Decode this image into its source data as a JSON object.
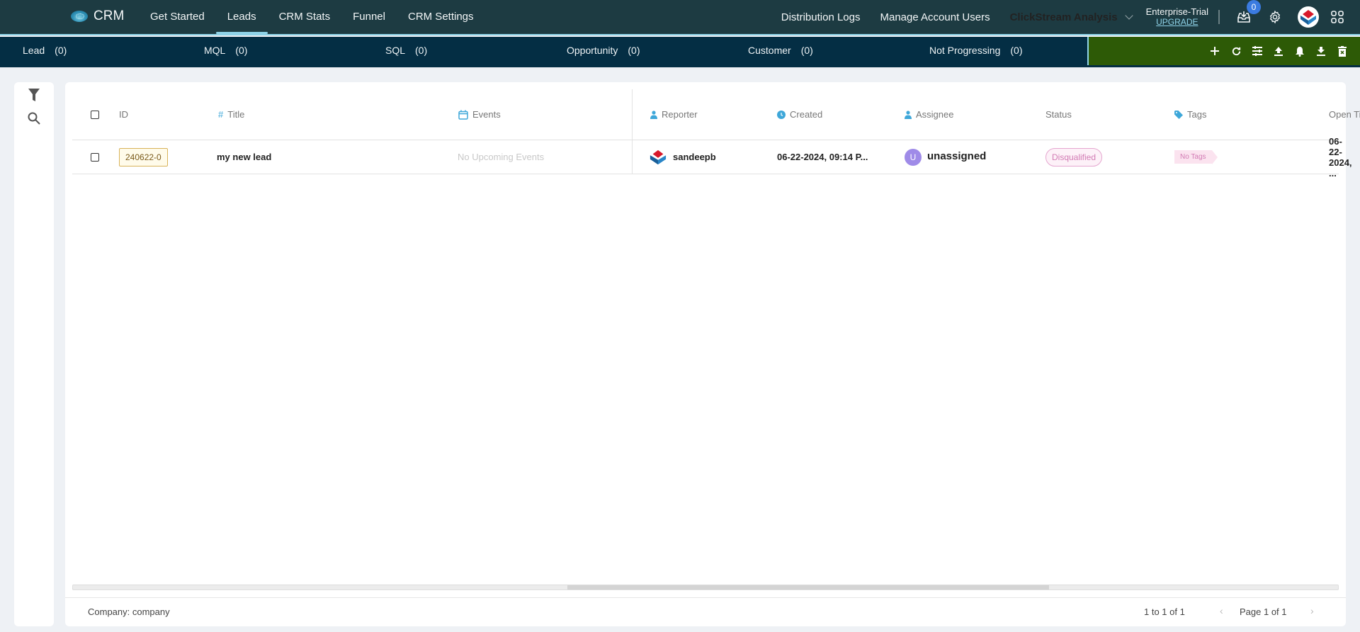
{
  "topnav": {
    "app_name": "CRM",
    "links": [
      "Get Started",
      "Leads",
      "CRM Stats",
      "Funnel",
      "CRM Settings"
    ],
    "active_link": "Leads",
    "right_links": [
      "Distribution Logs",
      "Manage Account Users"
    ],
    "workspace": "ClickStream Analysis",
    "plan": "Enterprise-Trial",
    "upgrade_label": "UPGRADE",
    "inbox_badge": "0"
  },
  "stages": [
    {
      "label": "Lead",
      "count": "(0)"
    },
    {
      "label": "MQL",
      "count": "(0)"
    },
    {
      "label": "SQL",
      "count": "(0)"
    },
    {
      "label": "Opportunity",
      "count": "(0)"
    },
    {
      "label": "Customer",
      "count": "(0)"
    },
    {
      "label": "Not Progressing",
      "count": "(0)"
    }
  ],
  "actions": [
    "add-icon",
    "refresh-icon",
    "column-settings-icon",
    "upload-icon",
    "bell-icon",
    "download-icon",
    "delete-icon"
  ],
  "colors": {
    "topnav_bg": "#1d3b42",
    "stagebar_bg": "#042e44",
    "actionbar_bg": "#2d5a06",
    "accent": "#8fd3e8"
  },
  "grid": {
    "columns": [
      "ID",
      "Title",
      "Events",
      "Reporter",
      "Created",
      "Assignee",
      "Status",
      "Tags",
      "Open Time"
    ],
    "rows": [
      {
        "id": "240622-0",
        "title": "my new lead",
        "events": "No Upcoming Events",
        "reporter": "sandeepb",
        "created": "06-22-2024, 09:14 P...",
        "assignee_initial": "U",
        "assignee": "unassigned",
        "status": "Disqualified",
        "tags": "No Tags",
        "open_time": "06-22-2024, ..."
      }
    ]
  },
  "footer": {
    "company": "Company: company",
    "range": "1 to 1 of 1",
    "page": "Page 1 of 1"
  }
}
